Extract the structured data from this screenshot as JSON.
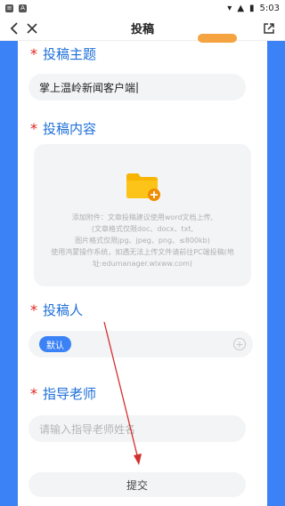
{
  "status": {
    "time": "5:03"
  },
  "header": {
    "title": "投稿"
  },
  "topic": {
    "label": "投稿主题",
    "value": "掌上温岭新闻客户端"
  },
  "content": {
    "label": "投稿内容",
    "upload_lines": [
      "添加附件：文章投稿建议使用word文档上传,",
      "(文章格式仅限doc、docx、txt,",
      "图片格式仅限jpg、jpeg、png、≤800kb)",
      "使用鸿蒙操作系统，如遇无法上传文件请前往PC端投稿(地",
      "址:edumanager.wlxww.com)"
    ]
  },
  "author": {
    "label": "投稿人",
    "tag": "默认"
  },
  "mentor": {
    "label": "指导老师",
    "placeholder": "请输入指导老师姓名"
  },
  "submit": {
    "label": "提交"
  },
  "colors": {
    "accent": "#3b82f6",
    "label": "#1e6fd9",
    "required": "#e02424",
    "annotation": "#d32f2f"
  }
}
